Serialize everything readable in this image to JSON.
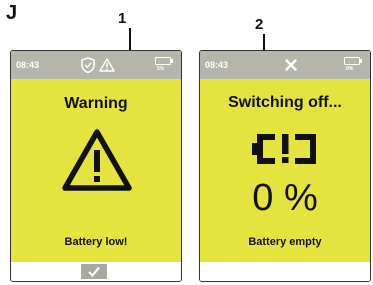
{
  "figure_label": "J",
  "callouts": [
    "1",
    "2"
  ],
  "left_panel": {
    "time": "08:43",
    "status_icons": [
      "shield-check-icon",
      "warning-icon"
    ],
    "battery_percent": "5%",
    "title": "Warning",
    "icon": "warning-triangle-icon",
    "message": "Battery low!",
    "confirm_button_icon": "checkmark-icon"
  },
  "right_panel": {
    "time": "08:43",
    "status_icons": [
      "x-icon"
    ],
    "battery_percent": "0%",
    "title": "Switching off...",
    "icon": "battery-empty-icon",
    "big_value": "0 %",
    "message": "Battery empty"
  },
  "colors": {
    "screen": "#e5e43e",
    "status_bar": "#b5b5ab",
    "ink": "#111111",
    "button": "#a8a8a0"
  }
}
